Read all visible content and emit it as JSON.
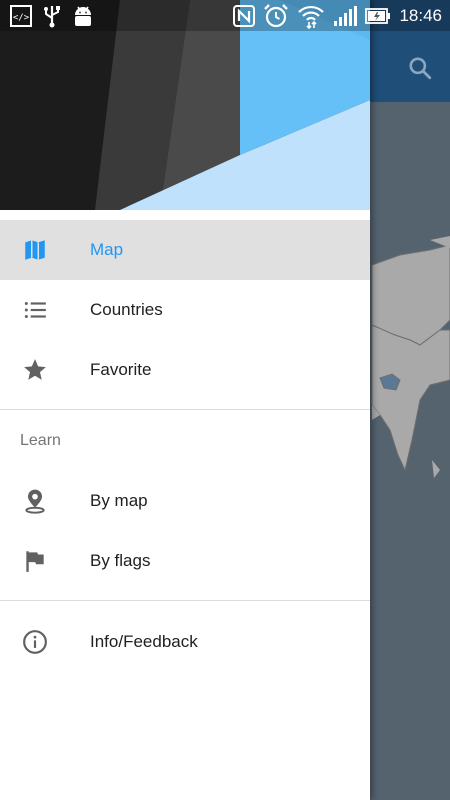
{
  "status_bar": {
    "time": "18:46",
    "left_icons": [
      "code-icon",
      "usb-icon",
      "android-icon"
    ],
    "right_icons": [
      "nfc-icon",
      "alarm-icon",
      "wifi-icon",
      "signal-icon",
      "battery-icon"
    ]
  },
  "app": {
    "toolbar_color": "#1f4e79",
    "search_icon": "search-icon"
  },
  "drawer": {
    "accent": "#2196f3",
    "items": [
      {
        "label": "Map",
        "icon": "map-icon",
        "active": true
      },
      {
        "label": "Countries",
        "icon": "list-icon",
        "active": false
      },
      {
        "label": "Favorite",
        "icon": "star-icon",
        "active": false
      }
    ],
    "learn": {
      "title": "Learn",
      "items": [
        {
          "label": "By map",
          "icon": "location-pin-icon"
        },
        {
          "label": "By flags",
          "icon": "flag-icon"
        }
      ]
    },
    "footer_items": [
      {
        "label": "Info/Feedback",
        "icon": "info-icon"
      }
    ]
  }
}
